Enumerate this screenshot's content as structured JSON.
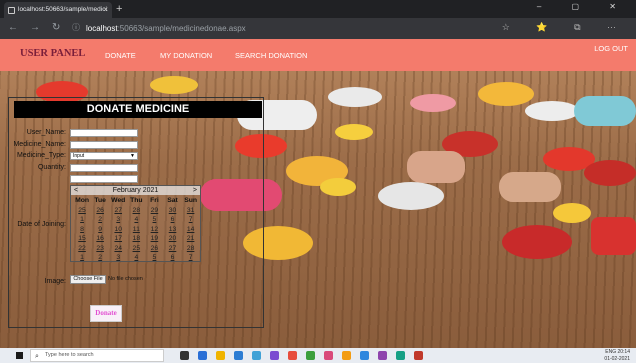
{
  "browser": {
    "tab_title": "localhost:50663/sample/medici",
    "tab_close": "×",
    "new_tab": "+",
    "window_controls": "–  ▢  ✕",
    "url_host": "localhost",
    "url_path": ":50663/sample/medicinedonae.aspx",
    "nav_back": "←",
    "nav_forward": "→",
    "nav_reload": "↻",
    "info_icon": "ⓘ",
    "addr_icons": "☆ ⭐ ⧉ ⋯"
  },
  "header": {
    "brand": "USER PANEL",
    "nav": [
      "DONATE",
      "MY DONATION",
      "SEARCH DONATION"
    ],
    "logout": "LOG OUT",
    "bg_color": "#f47b6c",
    "brand_color": "#7a1e3a"
  },
  "form": {
    "title": "DONATE MEDICINE",
    "labels": {
      "user_name": "User_Name:",
      "medicine_name": "Medicine_Name:",
      "medicine_type": "Medicine_Type:",
      "quantity": "Quantity:",
      "date_of_joining": "Date of Joining:",
      "image": "Image:"
    },
    "user_name_value": "",
    "medicine_name_value": "",
    "medicine_type_selected": "Input",
    "quantity_value": "",
    "quantity2_value": "",
    "file_button": "Choose File",
    "file_status": "No file chosen",
    "donate_button": "Donate",
    "donate_color": "#e24fd2"
  },
  "calendar": {
    "title": "February 2021",
    "prev": "<",
    "next": ">",
    "days_of_week": [
      "Mon",
      "Tue",
      "Wed",
      "Thu",
      "Fri",
      "Sat",
      "Sun"
    ],
    "weeks": [
      [
        "25",
        "26",
        "27",
        "28",
        "29",
        "30",
        "31"
      ],
      [
        "1",
        "2",
        "3",
        "4",
        "5",
        "6",
        "7"
      ],
      [
        "8",
        "9",
        "10",
        "11",
        "12",
        "13",
        "14"
      ],
      [
        "15",
        "16",
        "17",
        "18",
        "19",
        "20",
        "21"
      ],
      [
        "22",
        "23",
        "24",
        "25",
        "26",
        "27",
        "28"
      ],
      [
        "1",
        "2",
        "3",
        "4",
        "5",
        "6",
        "7"
      ]
    ]
  },
  "taskbar": {
    "search_placeholder": "Type here to search",
    "search_icon": "⌕",
    "tray_time": "20:14",
    "tray_date": "01-02-2021",
    "tray_lang": "ENG"
  }
}
